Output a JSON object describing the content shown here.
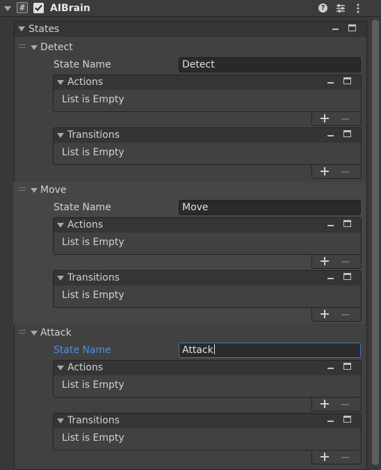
{
  "component": {
    "title": "AIBrain",
    "enabled": true,
    "script_icon": "#"
  },
  "states_header": "States",
  "list_empty": "List is Empty",
  "states": [
    {
      "name": "Detect",
      "field_label": "State Name",
      "field_value": "Detect",
      "actions_label": "Actions",
      "transitions_label": "Transitions"
    },
    {
      "name": "Move",
      "field_label": "State Name",
      "field_value": "Move",
      "actions_label": "Actions",
      "transitions_label": "Transitions"
    },
    {
      "name": "Attack",
      "field_label": "State Name",
      "field_value": "Attack",
      "actions_label": "Actions",
      "transitions_label": "Transitions"
    }
  ],
  "colors": {
    "background": "#383838",
    "focused_label": "#4d8fe0",
    "focus_border": "#3a79bb",
    "selected_row": "#464646"
  },
  "icons": [
    "foldout-arrow-icon",
    "script-icon",
    "checkbox-icon",
    "help-icon",
    "preset-icon",
    "kebab-menu-icon",
    "drag-handle-icon",
    "minus-icon",
    "maximize-icon",
    "plus-icon"
  ]
}
